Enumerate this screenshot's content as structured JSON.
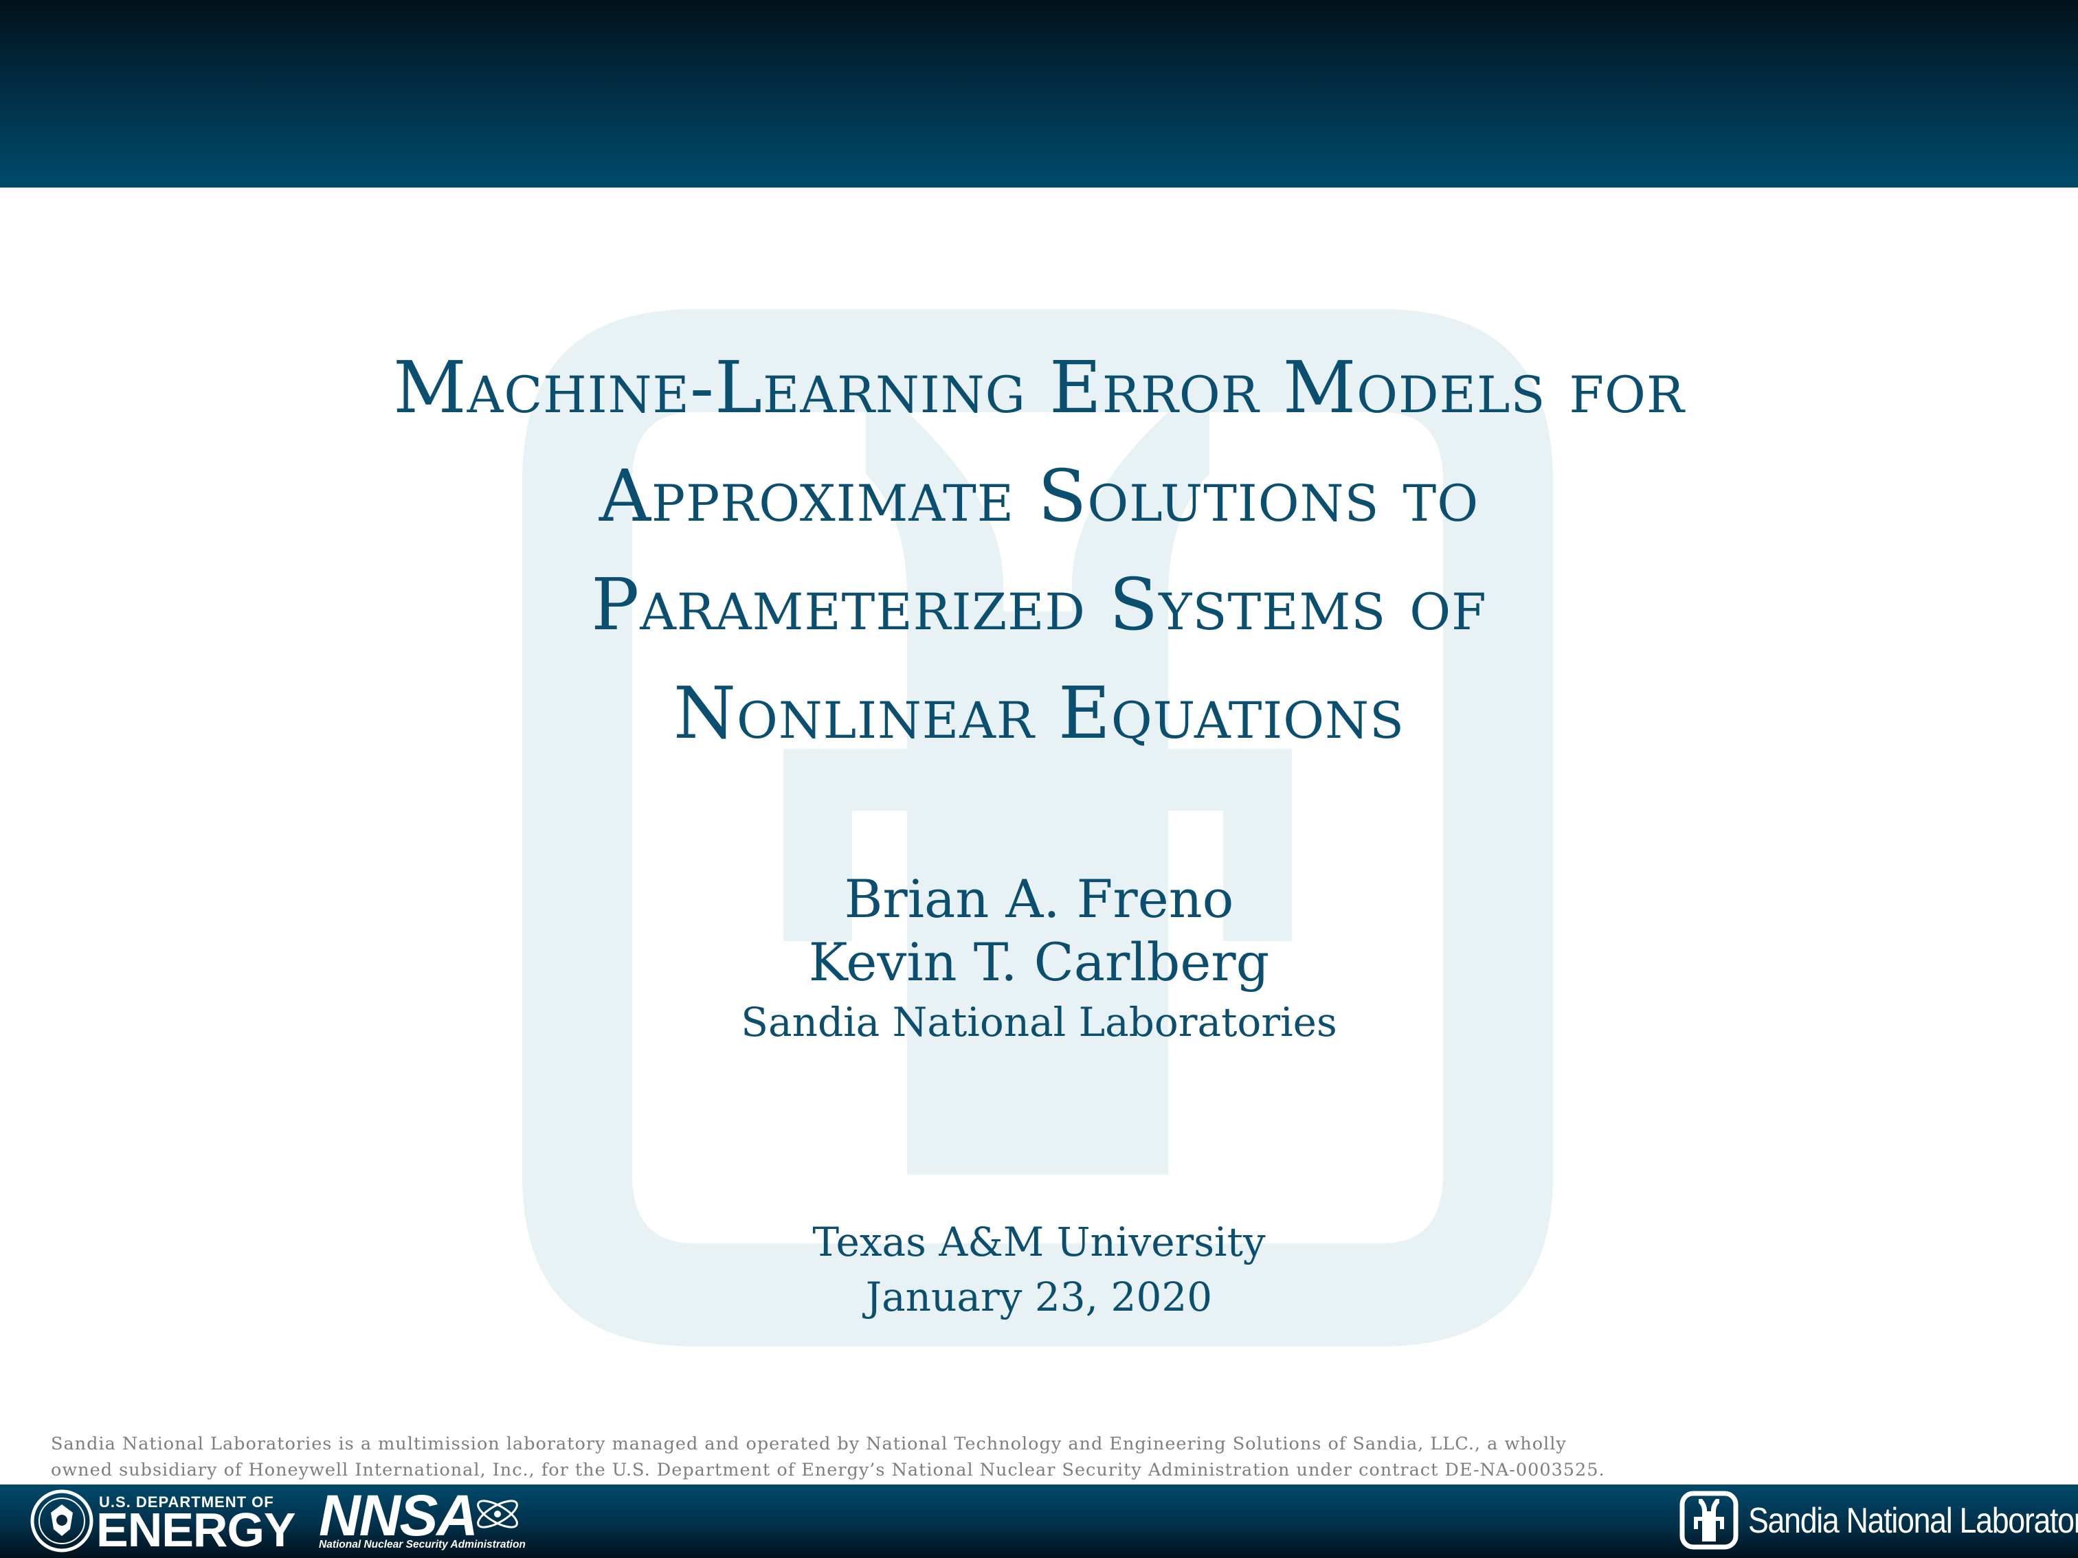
{
  "slide": {
    "title_lines": [
      "Machine-Learning Error Models for",
      "Approximate Solutions to",
      "Parameterized Systems of",
      "Nonlinear Equations"
    ],
    "authors": [
      "Brian A. Freno",
      "Kevin T. Carlberg"
    ],
    "affiliation": "Sandia National Laboratories",
    "venue": "Texas A&M University",
    "date": "January 23, 2020"
  },
  "footer": {
    "disclaimer_lines": [
      "Sandia National Laboratories is a multimission laboratory managed and operated by National Technology and Engineering Solutions of Sandia, LLC., a wholly",
      "owned subsidiary of Honeywell International, Inc., for the U.S. Department of Energy’s National Nuclear Security Administration under contract DE-NA-0003525."
    ],
    "logos": {
      "doe_top": "U.S. DEPARTMENT OF",
      "doe_main": "ENERGY",
      "nnsa_word": "NNSA",
      "nnsa_sub": "National Nuclear Security Administration",
      "sandia_name": "Sandia National Laboratories"
    }
  },
  "colors": {
    "title_text": "#0b4f70",
    "band_dark": "#03111b",
    "band_light": "#004a6c",
    "watermark": "#e8f1f4",
    "disclaimer_text": "#7e7e7e"
  },
  "icons": [
    "sandia-thunderbird-watermark-icon",
    "doe-seal-icon",
    "nnsa-atom-icon",
    "sandia-thunderbird-icon"
  ]
}
